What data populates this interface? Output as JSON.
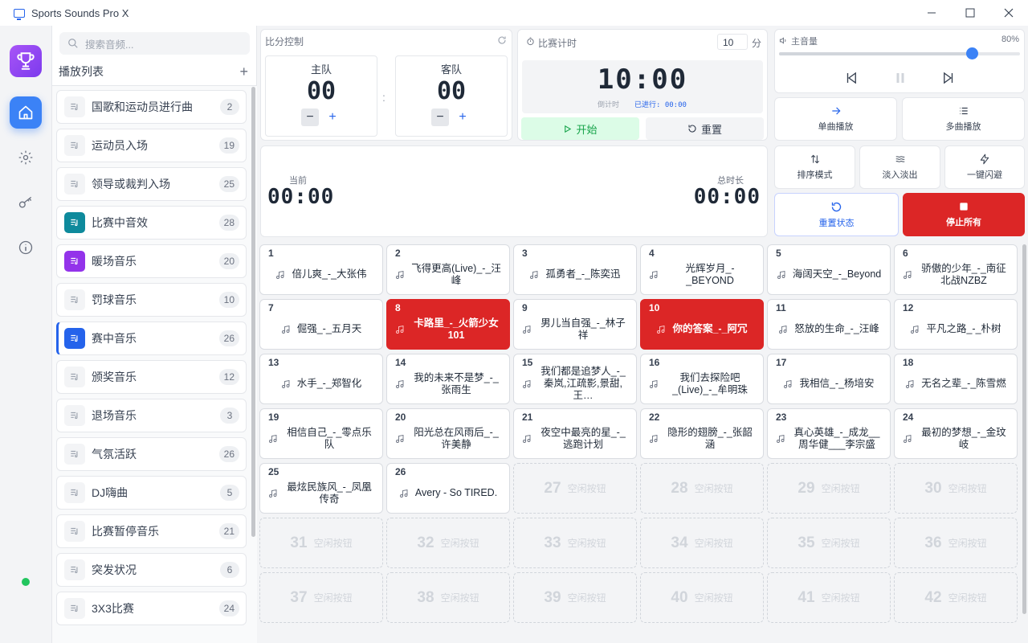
{
  "app": {
    "title": "Sports Sounds Pro X"
  },
  "search": {
    "placeholder": "搜索音频..."
  },
  "playlist": {
    "title": "播放列表",
    "items": [
      {
        "name": "国歌和运动员进行曲",
        "count": "2",
        "color": "#f3f4f6"
      },
      {
        "name": "运动员入场",
        "count": "19",
        "color": "#f3f4f6"
      },
      {
        "name": "领导或裁判入场",
        "count": "25",
        "color": "#f3f4f6"
      },
      {
        "name": "比赛中音效",
        "count": "28",
        "color": "#0e8a9c"
      },
      {
        "name": "暖场音乐",
        "count": "20",
        "color": "#9333ea"
      },
      {
        "name": "罚球音乐",
        "count": "10",
        "color": "#f3f4f6"
      },
      {
        "name": "赛中音乐",
        "count": "26",
        "color": "#2563eb"
      },
      {
        "name": "颁奖音乐",
        "count": "12",
        "color": "#f3f4f6"
      },
      {
        "name": "退场音乐",
        "count": "3",
        "color": "#f3f4f6"
      },
      {
        "name": "气氛活跃",
        "count": "26",
        "color": "#f3f4f6"
      },
      {
        "name": "DJ嗨曲",
        "count": "5",
        "color": "#f3f4f6"
      },
      {
        "name": "比赛暂停音乐",
        "count": "21",
        "color": "#f3f4f6"
      },
      {
        "name": "突发状况",
        "count": "6",
        "color": "#f3f4f6"
      },
      {
        "name": "3X3比赛",
        "count": "24",
        "color": "#f3f4f6"
      }
    ]
  },
  "score": {
    "title": "比分控制",
    "home_label": "主队",
    "home_score": "00",
    "away_label": "客队",
    "away_score": "00",
    "separator": ":"
  },
  "timer": {
    "title": "比赛计时",
    "minutes": "10",
    "unit": "分",
    "display": "10:00",
    "countdown_label": "倒计时",
    "elapsed_label": "已进行: 00:00",
    "start_label": "开始",
    "reset_label": "重置"
  },
  "progress": {
    "current_label": "当前",
    "current_time": "00:00",
    "total_label": "总时长",
    "total_time": "00:00"
  },
  "volume": {
    "label": "主音量",
    "value": "80%",
    "level": 0.8
  },
  "controls": {
    "single": "单曲播放",
    "multi": "多曲播放",
    "sort": "排序模式",
    "fade": "淡入淡出",
    "dodge": "一键闪避",
    "reset_state": "重置状态",
    "stop_all": "停止所有"
  },
  "buttons": [
    {
      "num": "1",
      "title": "倍儿爽_-_大张伟",
      "active": false
    },
    {
      "num": "2",
      "title": "飞得更高(Live)_-_汪峰",
      "active": false
    },
    {
      "num": "3",
      "title": "孤勇者_-_陈奕迅",
      "active": false
    },
    {
      "num": "4",
      "title": "光辉岁月_-_BEYOND",
      "active": false
    },
    {
      "num": "5",
      "title": "海阔天空_-_Beyond",
      "active": false
    },
    {
      "num": "6",
      "title": "骄傲的少年_-_南征北战NZBZ",
      "active": false
    },
    {
      "num": "7",
      "title": "倔强_-_五月天",
      "active": false
    },
    {
      "num": "8",
      "title": "卡路里_-_火箭少女101",
      "active": true
    },
    {
      "num": "9",
      "title": "男儿当自强_-_林子祥",
      "active": false
    },
    {
      "num": "10",
      "title": "你的答案_-_阿冗",
      "active": true
    },
    {
      "num": "11",
      "title": "怒放的生命_-_汪峰",
      "active": false
    },
    {
      "num": "12",
      "title": "平凡之路_-_朴树",
      "active": false
    },
    {
      "num": "13",
      "title": "水手_-_郑智化",
      "active": false
    },
    {
      "num": "14",
      "title": "我的未来不是梦_-_张雨生",
      "active": false
    },
    {
      "num": "15",
      "title": "我们都是追梦人_-_秦岚,江疏影,景甜,王…",
      "active": false
    },
    {
      "num": "16",
      "title": "我们去探险吧_(Live)_-_牟明珠",
      "active": false
    },
    {
      "num": "17",
      "title": "我相信_-_杨培安",
      "active": false
    },
    {
      "num": "18",
      "title": "无名之辈_-_陈雪燃",
      "active": false
    },
    {
      "num": "19",
      "title": "相信自己_-_零点乐队",
      "active": false
    },
    {
      "num": "20",
      "title": "阳光总在风雨后_-_许美静",
      "active": false
    },
    {
      "num": "21",
      "title": "夜空中最亮的星_-_逃跑计划",
      "active": false
    },
    {
      "num": "22",
      "title": "隐形的翅膀_-_张韶涵",
      "active": false
    },
    {
      "num": "23",
      "title": "真心英雄_-_成龙__周华健___李宗盛",
      "active": false
    },
    {
      "num": "24",
      "title": "最初的梦想_-_金玟岐",
      "active": false
    },
    {
      "num": "25",
      "title": "最炫民族风_-_凤凰传奇",
      "active": false
    },
    {
      "num": "26",
      "title": "Avery - So TIRED.",
      "active": false
    }
  ],
  "empty_label": "空闲按钮",
  "empty_numbers": [
    "27",
    "28",
    "29",
    "30",
    "31",
    "32",
    "33",
    "34",
    "35",
    "36",
    "37",
    "38",
    "39",
    "40",
    "41",
    "42"
  ]
}
